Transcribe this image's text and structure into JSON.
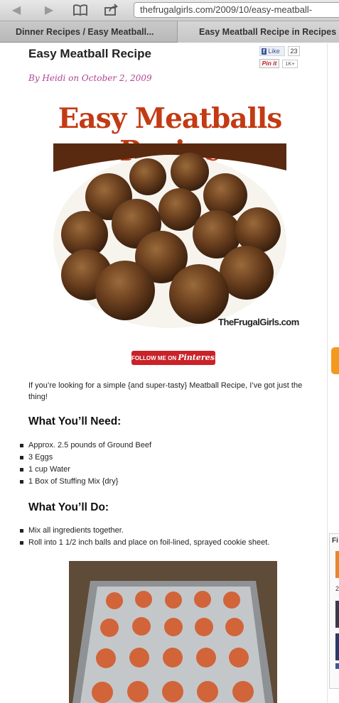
{
  "browser": {
    "url": "thefrugalgirls.com/2009/10/easy-meatball-",
    "back_icon": "back-arrow-icon",
    "forward_icon": "forward-arrow-icon",
    "reader_icon": "book-icon",
    "share_icon": "share-icon"
  },
  "tabs": [
    {
      "label": "Dinner Recipes / Easy Meatball..."
    },
    {
      "label": "Easy Meatball Recipe in Recipes"
    }
  ],
  "post": {
    "title": "Easy Meatball Recipe",
    "byline": "By Heidi on October 2, 2009",
    "like_label": "Like",
    "like_count": "23",
    "pin_label": "Pin it",
    "pin_count": "1K+"
  },
  "hero": {
    "title": "Easy Meatballs Recipe",
    "credit": "TheFrugalGirls.com"
  },
  "pinterest_follow": {
    "prefix": "FOLLOW ME ON",
    "brand": "Pinterest"
  },
  "intro": "If you’re looking for a simple {and super-tasty} Meatball Recipe, I’ve got just the thing!",
  "needs": {
    "heading": "What You’ll Need:",
    "items": [
      "Approx. 2.5 pounds of Ground Beef",
      "3 Eggs",
      "1 cup Water",
      "1 Box of Stuffing Mix {dry}"
    ]
  },
  "steps": {
    "heading": "What You’ll Do:",
    "items": [
      "Mix all ingredients together.",
      "Roll into 1 1/2 inch balls and place on foil-lined, sprayed cookie sheet."
    ]
  },
  "sidebar": {
    "widget_label": "Fi",
    "number": "2"
  },
  "colors": {
    "byline": "#b04592",
    "hero_title": "#c23b14",
    "pinterest": "#c92228",
    "facebook": "#3b5998"
  }
}
